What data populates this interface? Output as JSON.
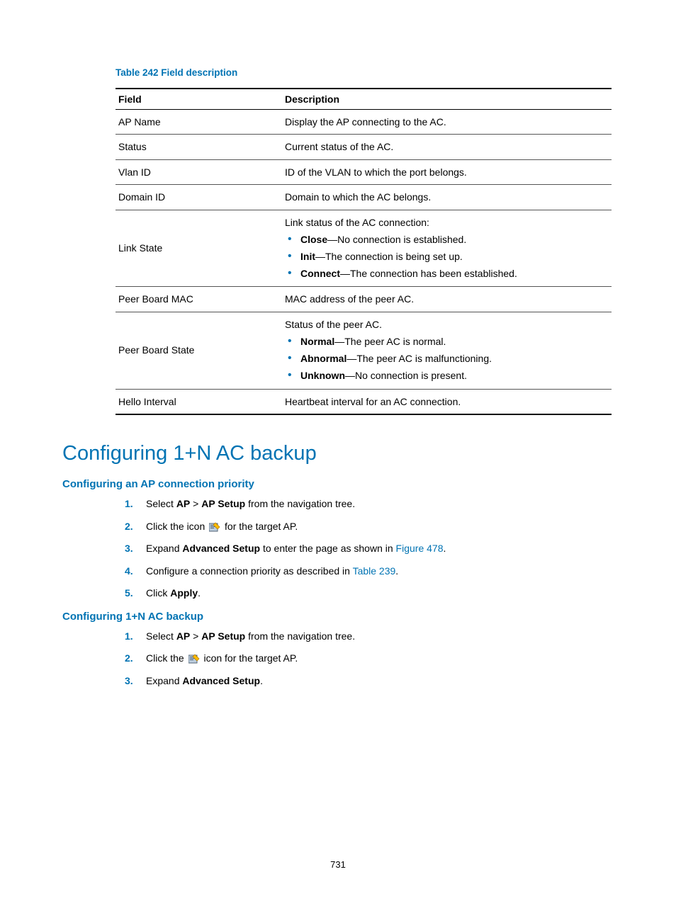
{
  "table": {
    "caption": "Table 242 Field description",
    "headers": {
      "field": "Field",
      "desc": "Description"
    },
    "rows": {
      "ap_name": {
        "field": "AP Name",
        "desc": "Display the AP connecting to the AC."
      },
      "status": {
        "field": "Status",
        "desc": "Current status of the AC."
      },
      "vlan_id": {
        "field": "Vlan ID",
        "desc": "ID of the VLAN to which the port belongs."
      },
      "domain_id": {
        "field": "Domain ID",
        "desc": "Domain to which the AC belongs."
      },
      "link_state": {
        "field": "Link State",
        "desc_lead": "Link status of the AC connection:",
        "items": {
          "close": {
            "b": "Close",
            "t": "—No connection is established."
          },
          "init": {
            "b": "Init",
            "t": "—The connection is being set up."
          },
          "connect": {
            "b": "Connect",
            "t": "—The connection has been established."
          }
        }
      },
      "peer_mac": {
        "field": "Peer Board MAC",
        "desc": "MAC address of the peer AC."
      },
      "peer_state": {
        "field": "Peer Board State",
        "desc_lead": "Status of the peer AC.",
        "items": {
          "normal": {
            "b": "Normal",
            "t": "—The peer AC is normal."
          },
          "abnormal": {
            "b": "Abnormal",
            "t": "—The peer AC is malfunctioning."
          },
          "unknown": {
            "b": "Unknown",
            "t": "—No connection is present."
          }
        }
      },
      "hello": {
        "field": "Hello Interval",
        "desc": "Heartbeat interval for an AC connection."
      }
    }
  },
  "h1": "Configuring 1+N AC backup",
  "sec1": {
    "title": "Configuring an AP connection priority",
    "s1_a": "Select ",
    "s1_b": "AP",
    "s1_c": " > ",
    "s1_d": "AP Setup",
    "s1_e": " from the navigation tree.",
    "s2_a": "Click the icon ",
    "s2_b": " for the target AP.",
    "s3_a": "Expand ",
    "s3_b": "Advanced Setup",
    "s3_c": " to enter the page as shown in ",
    "s3_link": "Figure 478",
    "s3_d": ".",
    "s4_a": "Configure a connection priority as described in ",
    "s4_link": "Table 239",
    "s4_b": ".",
    "s5_a": "Click ",
    "s5_b": "Apply",
    "s5_c": "."
  },
  "sec2": {
    "title": "Configuring 1+N AC backup",
    "s1_a": "Select ",
    "s1_b": "AP",
    "s1_c": " > ",
    "s1_d": "AP Setup",
    "s1_e": " from the navigation tree.",
    "s2_a": "Click the ",
    "s2_b": " icon for the target AP.",
    "s3_a": "Expand ",
    "s3_b": "Advanced Setup",
    "s3_c": "."
  },
  "page_number": "731"
}
